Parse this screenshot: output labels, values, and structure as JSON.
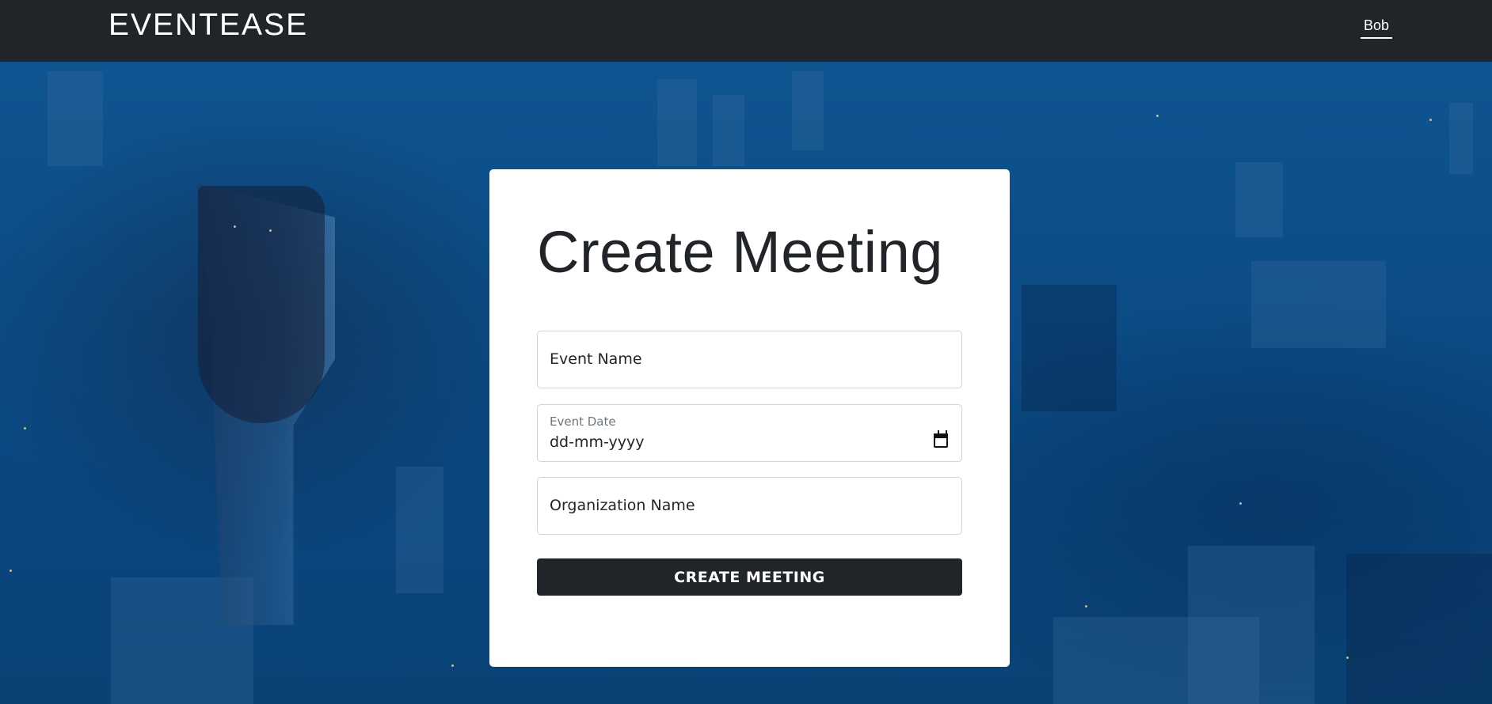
{
  "navbar": {
    "brand": "EVENTEASE",
    "user": "Bob"
  },
  "form": {
    "title": "Create Meeting",
    "event_name_placeholder": "Event Name",
    "event_date_label": "Event Date",
    "event_date_value": "dd-mm-yyyy",
    "organization_placeholder": "Organization Name",
    "submit_label": "CREATE MEETING"
  },
  "icons": {
    "date_picker": "calendar-icon"
  },
  "colors": {
    "navbar": "#212529",
    "background": "#0c4a80",
    "button": "#212529",
    "card": "#ffffff"
  }
}
